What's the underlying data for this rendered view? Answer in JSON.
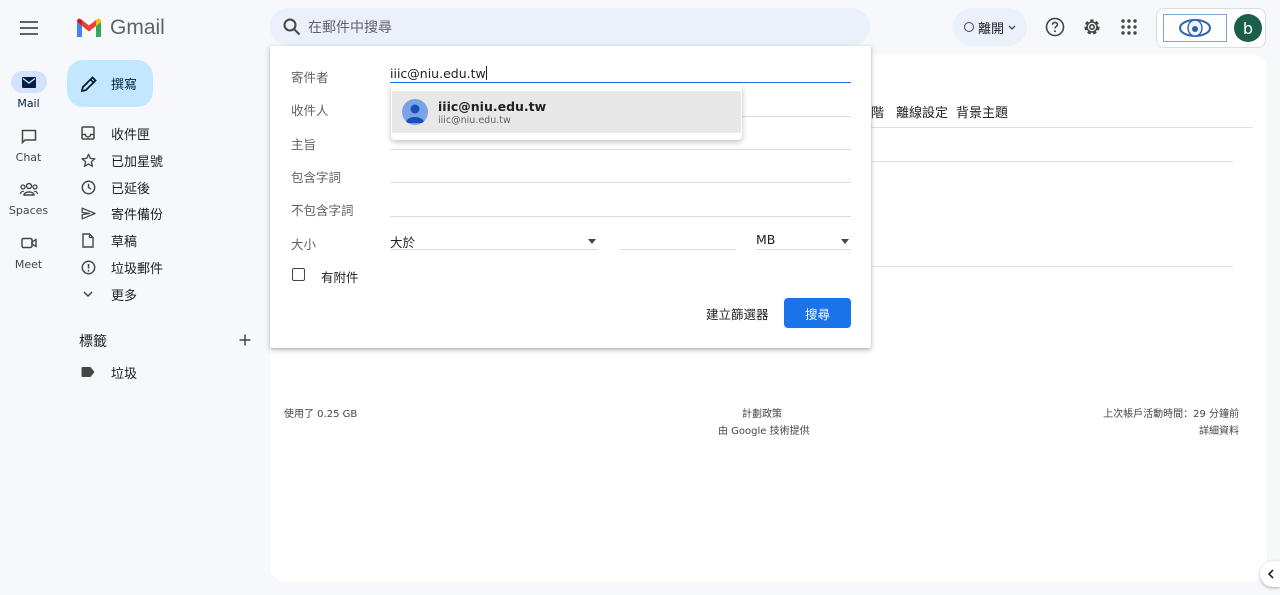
{
  "app": {
    "name": "Gmail"
  },
  "search": {
    "placeholder": "在郵件中搜尋"
  },
  "status": {
    "label": "離開"
  },
  "profile": {
    "initial": "b"
  },
  "rail": [
    {
      "label": "Mail",
      "icon": "mail-icon",
      "active": true
    },
    {
      "label": "Chat",
      "icon": "chat-icon",
      "active": false
    },
    {
      "label": "Spaces",
      "icon": "spaces-icon",
      "active": false
    },
    {
      "label": "Meet",
      "icon": "meet-icon",
      "active": false
    }
  ],
  "compose": {
    "label": "撰寫"
  },
  "nav": [
    {
      "label": "收件匣",
      "icon": "inbox-icon"
    },
    {
      "label": "已加星號",
      "icon": "star-icon"
    },
    {
      "label": "已延後",
      "icon": "clock-icon"
    },
    {
      "label": "寄件備份",
      "icon": "send-icon"
    },
    {
      "label": "草稿",
      "icon": "draft-icon"
    },
    {
      "label": "垃圾郵件",
      "icon": "spam-icon"
    },
    {
      "label": "更多",
      "icon": "chevron-down-icon"
    }
  ],
  "labels": {
    "heading": "標籤",
    "items": [
      {
        "label": "垃圾",
        "icon": "label-icon"
      }
    ]
  },
  "settings_tabs": {
    "fragment": "階",
    "offline": "離線設定",
    "themes": "背景主題"
  },
  "footer": {
    "storage": "使用了 0.25 GB",
    "policy": "計劃政策",
    "powered": "由 Google 技術提供",
    "last_activity": "上次帳戶活動時間：29 分鐘前",
    "details": "詳細資料"
  },
  "advanced_search": {
    "from_label": "寄件者",
    "from_value": "iiic@niu.edu.tw",
    "to_label": "收件人",
    "subject_label": "主旨",
    "has_words_label": "包含字詞",
    "no_words_label": "不包含字詞",
    "size_label": "大小",
    "size_op": "大於",
    "size_unit": "MB",
    "attachment_label": "有附件",
    "create_filter": "建立篩選器",
    "search_button": "搜尋",
    "suggestion": {
      "name": "iiic@niu.edu.tw",
      "email": "iiic@niu.edu.tw"
    }
  },
  "colors": {
    "accent": "#1a73e8",
    "compose_bg": "#c2e7ff",
    "background": "#f6f8fc"
  }
}
